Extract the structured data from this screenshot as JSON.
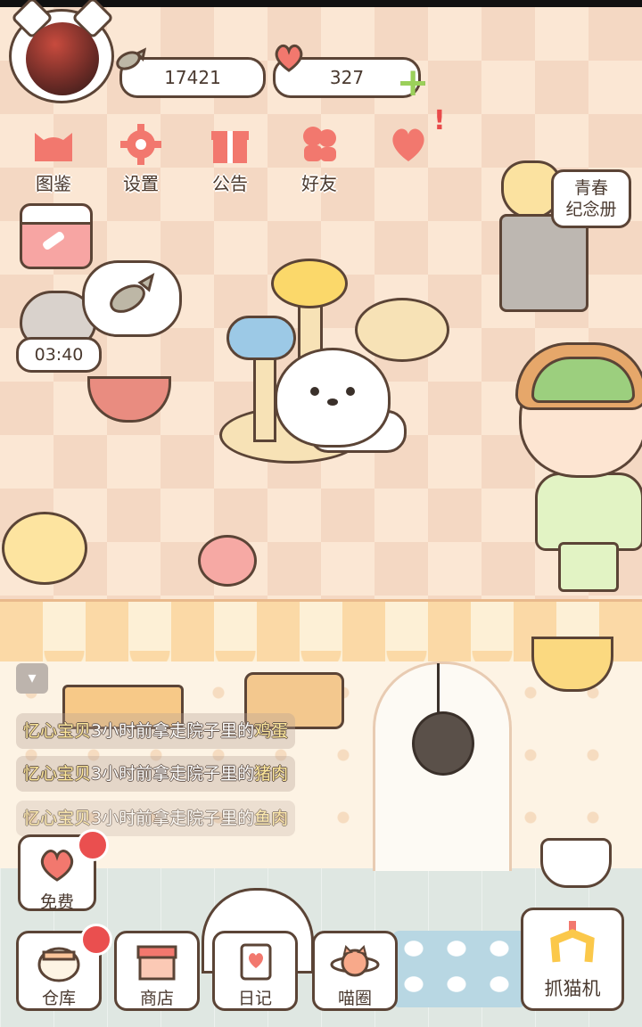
{
  "hud": {
    "fish_currency": "17421",
    "heart_currency": "327",
    "plus_label": "+"
  },
  "top_menu": [
    {
      "id": "handbook",
      "label": "图鉴",
      "icon": "cat-face-icon",
      "color": "#f2786e"
    },
    {
      "id": "settings",
      "label": "设置",
      "icon": "gear-icon",
      "color": "#f2786e"
    },
    {
      "id": "notice",
      "label": "公告",
      "icon": "gift-icon",
      "color": "#f2786e"
    },
    {
      "id": "friends",
      "label": "好友",
      "icon": "friends-icon",
      "color": "#f2786e"
    }
  ],
  "album": {
    "line1": "青春",
    "line2": "纪念册"
  },
  "timer": "03:40",
  "chat": {
    "messages": [
      {
        "name": "忆心宝贝",
        "text": "3小时前拿走院子里的",
        "item": "鸡蛋"
      },
      {
        "name": "忆心宝贝",
        "text": "3小时前拿走院子里的",
        "item": "猪肉"
      },
      {
        "name": "忆心宝贝",
        "text": "3小时前拿走院子里的",
        "item": "鱼肉"
      }
    ]
  },
  "bottom": {
    "free": "免费",
    "warehouse": "仓库",
    "shop": "商店",
    "diary": "日记",
    "meow_circle": "喵圈",
    "claw_machine": "抓猫机"
  },
  "colors": {
    "outline": "#5b4436",
    "accent_pink": "#f2786e",
    "alert_red": "#ea4f4f",
    "plus_green": "#9bd05a"
  }
}
